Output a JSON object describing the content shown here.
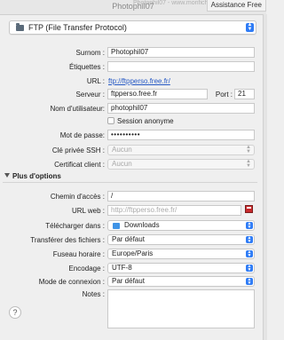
{
  "window": {
    "title": "Photophil07",
    "ghost_title": "Photophil07 - www.monfichier.fr",
    "assist_button": "Assistance Free"
  },
  "protocol": {
    "value": "FTP (File Transfer Protocol)"
  },
  "fields": {
    "surnom": {
      "label": "Surnom :",
      "value": "Photophil07"
    },
    "etiquettes": {
      "label": "Étiquettes :",
      "value": ""
    },
    "url": {
      "label": "URL :",
      "value": "ftp://ftpperso.free.fr/"
    },
    "serveur": {
      "label": "Serveur :",
      "value": "ftpperso.free.fr"
    },
    "port": {
      "label": "Port :",
      "value": "21"
    },
    "utilisateur": {
      "label": "Nom d'utilisateur:",
      "value": "photophil07"
    },
    "anonyme": {
      "label": "Session anonyme",
      "checked": false
    },
    "motdepasse": {
      "label": "Mot de passe:",
      "value": "••••••••••"
    },
    "cle_ssh": {
      "label": "Clé privée SSH :",
      "value": "Aucun"
    },
    "certificat": {
      "label": "Certificat client :",
      "value": "Aucun"
    }
  },
  "options": {
    "section_label": "Plus d'options",
    "chemin": {
      "label": "Chemin d'accès :",
      "value": "/"
    },
    "url_web": {
      "label": "URL web :",
      "placeholder": "http://ftpperso.free.fr/"
    },
    "telecharger": {
      "label": "Télécharger dans :",
      "value": "Downloads"
    },
    "transfert": {
      "label": "Transférer des fichiers :",
      "value": "Par défaut"
    },
    "fuseau": {
      "label": "Fuseau horaire :",
      "value": "Europe/Paris"
    },
    "encodage": {
      "label": "Encodage :",
      "value": "UTF-8"
    },
    "connexion": {
      "label": "Mode de connexion :",
      "value": "Par défaut"
    },
    "notes": {
      "label": "Notes :",
      "value": ""
    }
  },
  "help": {
    "glyph": "?"
  },
  "colors": {
    "accent": "#2f7cf6",
    "link": "#2659c4",
    "bookmark": "#c8282b"
  }
}
